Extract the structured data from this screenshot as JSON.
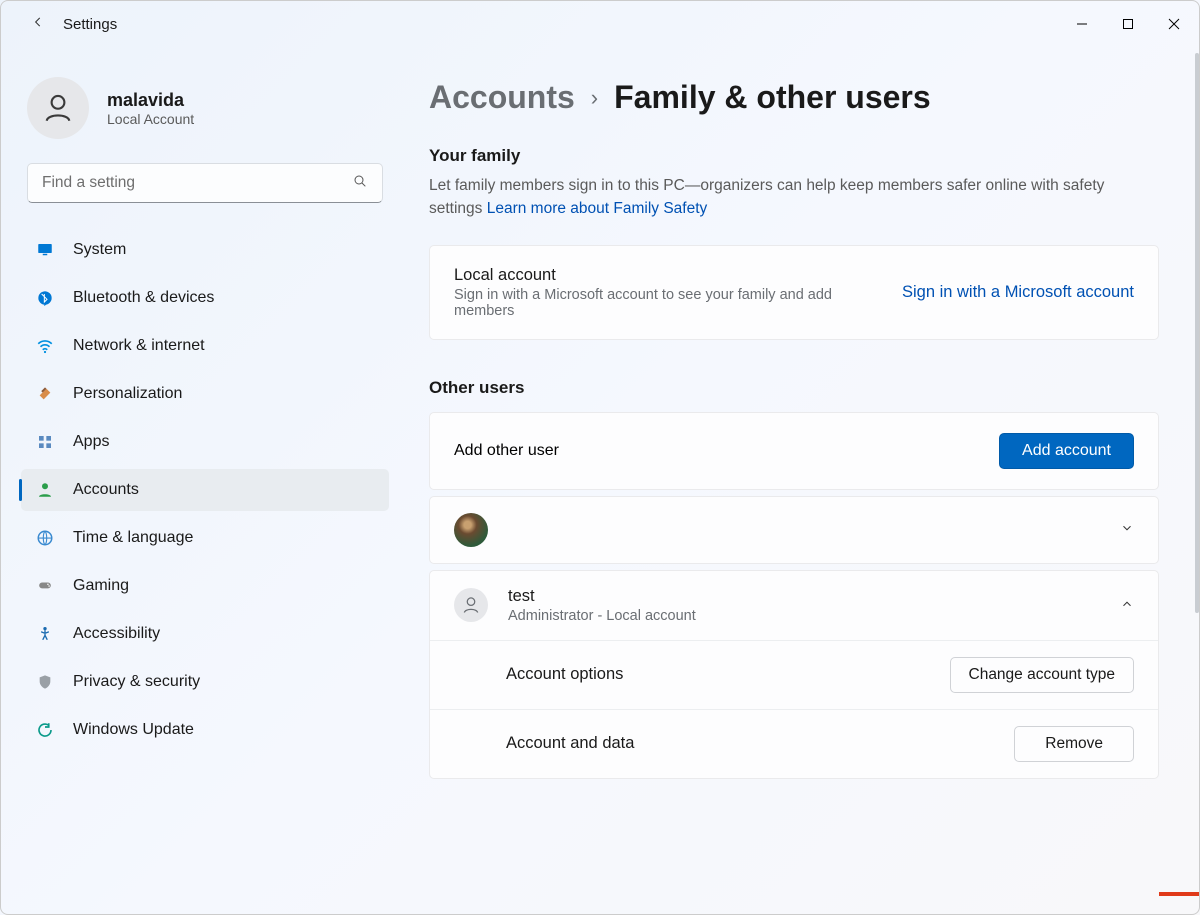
{
  "window": {
    "app_title": "Settings"
  },
  "user": {
    "name": "malavida",
    "subtitle": "Local Account"
  },
  "search": {
    "placeholder": "Find a setting"
  },
  "nav": [
    {
      "id": "system",
      "label": "System",
      "icon": "monitor"
    },
    {
      "id": "bluetooth",
      "label": "Bluetooth & devices",
      "icon": "bluetooth"
    },
    {
      "id": "network",
      "label": "Network & internet",
      "icon": "wifi"
    },
    {
      "id": "personalization",
      "label": "Personalization",
      "icon": "brush"
    },
    {
      "id": "apps",
      "label": "Apps",
      "icon": "apps"
    },
    {
      "id": "accounts",
      "label": "Accounts",
      "icon": "person",
      "active": true
    },
    {
      "id": "time",
      "label": "Time & language",
      "icon": "globe"
    },
    {
      "id": "gaming",
      "label": "Gaming",
      "icon": "gamepad"
    },
    {
      "id": "accessibility",
      "label": "Accessibility",
      "icon": "accessibility"
    },
    {
      "id": "privacy",
      "label": "Privacy & security",
      "icon": "shield"
    },
    {
      "id": "update",
      "label": "Windows Update",
      "icon": "update"
    }
  ],
  "breadcrumb": {
    "parent": "Accounts",
    "current": "Family & other users"
  },
  "family": {
    "heading": "Your family",
    "desc_prefix": "Let family members sign in to this PC—organizers can help keep members safer online with safety settings  ",
    "desc_link": "Learn more about Family Safety",
    "card_title": "Local account",
    "card_sub": "Sign in with a Microsoft account to see your family and add members",
    "signin_link": "Sign in with a Microsoft account"
  },
  "other": {
    "heading": "Other users",
    "add_label": "Add other user",
    "add_button": "Add account",
    "users": [
      {
        "name": "",
        "sub": "",
        "expanded": false,
        "has_photo": true
      },
      {
        "name": "test",
        "sub": "Administrator - Local account",
        "expanded": true,
        "has_photo": false
      }
    ],
    "account_options_label": "Account options",
    "change_type_button": "Change account type",
    "account_data_label": "Account and data",
    "remove_button": "Remove"
  }
}
